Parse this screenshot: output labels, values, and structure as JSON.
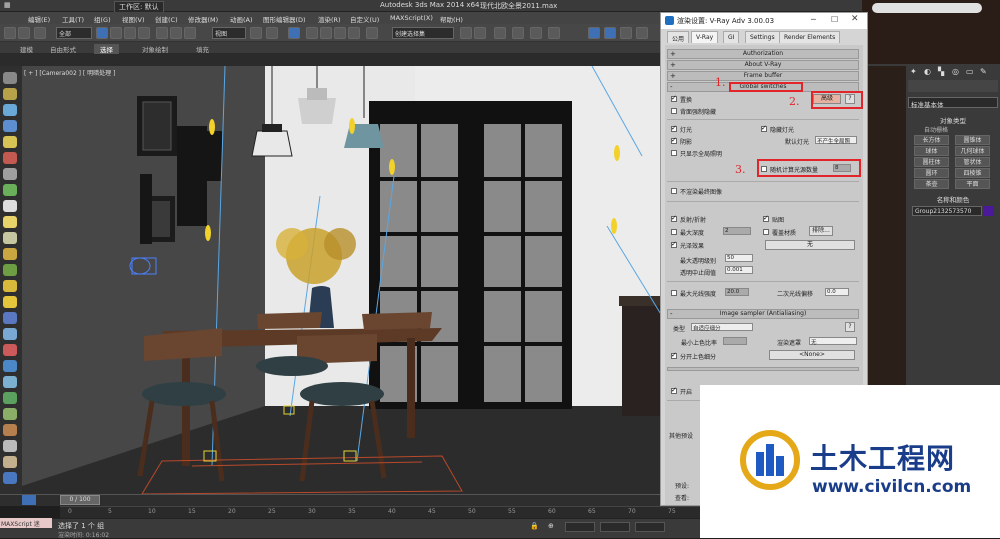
{
  "app": {
    "title": "Autodesk 3ds Max  2014 x64",
    "file": "现代北欧全景2011.max",
    "workspace": "工作区: 默认"
  },
  "menu": [
    "编辑(E)",
    "工具(T)",
    "组(G)",
    "视图(V)",
    "创建(C)",
    "修改器(M)",
    "动画(A)",
    "图形编辑器(D)",
    "渲染(R)",
    "自定义(U)",
    "MAXScript(X)",
    "帮助(H)"
  ],
  "toolbar": {
    "filter": "全部",
    "view": "视图",
    "selection_set": "创建选择集"
  },
  "ribbon": {
    "tabs": [
      "建模",
      "自由形式",
      "选择",
      "对象绘制",
      "填充"
    ],
    "active": "选择"
  },
  "viewport": {
    "label": "[ + ] [Camera002 ] [ 明暗处理 ]"
  },
  "dialog": {
    "title": "渲染设置: V-Ray Adv 3.00.03",
    "tabs": [
      "公用",
      "V-Ray",
      "GI",
      "Settings",
      "Render Elements"
    ],
    "active_tab": "V-Ray",
    "rollouts": [
      "Authorization",
      "About V-Ray",
      "Frame buffer",
      "Global switches"
    ],
    "global_switches": {
      "displacement": "置换",
      "force_backface": "背面强制隐藏",
      "mode_btn": "高级",
      "lights": "灯光",
      "hidden_lights": "隐藏灯光",
      "shadows": "阴影",
      "default_lights_label": "默认灯光",
      "default_lights_value": "不产生全局照",
      "show_gi_only": "只显示全局照明",
      "probabilistic_lights": "概率灯光",
      "prob_lights_label": "随机计算光源数量",
      "prob_lights_value": "8",
      "no_render_final": "不渲染最终图像",
      "reflect_refract": "反射/折射",
      "maps": "贴图",
      "max_depth": "最大深度",
      "max_depth_value": "2",
      "override_mtl": "覆盖材质",
      "exclude": "排除...",
      "override_value": "无",
      "glossy": "光泽效果",
      "max_transp": "最大透明级别",
      "max_transp_value": "50",
      "transp_cutoff": "透明中止阈值",
      "transp_cutoff_value": "0.001",
      "max_ray_intens": "最大光线强度",
      "max_ray_intens_value": "20.0",
      "secondary_bias": "二次光线偏移",
      "secondary_bias_value": "0.0"
    },
    "image_sampler": {
      "rollout": "Image sampler (Antialiasing)",
      "type_label": "类型",
      "type_value": "自适应细分",
      "min_shading": "最小上色比率",
      "render_mask": "渲染遮罩",
      "render_mask_value": "无",
      "divide_shading": "分开上色细分",
      "none_btn": "<None>",
      "on": "开启"
    },
    "bottom": {
      "label": "其他预设",
      "preset": "预设:",
      "view": "查看:"
    },
    "annotations": [
      "1.",
      "2.",
      "3."
    ]
  },
  "command_panel": {
    "dropdown": "标准基本体",
    "section_object_type": "对象类型",
    "autogrid": "自动栅格",
    "buttons": [
      "长方体",
      "圆锥体",
      "球体",
      "几何球体",
      "圆柱体",
      "管状体",
      "圆环",
      "四棱锥",
      "茶壶",
      "平面"
    ],
    "section_name_color": "名称和颜色",
    "object_name": "Group2132573570",
    "color": "#4a1a9a"
  },
  "timeline": {
    "slider": "0 / 100",
    "ticks": [
      "0",
      "5",
      "10",
      "15",
      "20",
      "25",
      "30",
      "35",
      "40",
      "45",
      "50",
      "55",
      "60",
      "65",
      "70",
      "75"
    ]
  },
  "status": {
    "maxscript": "MAXScript 迷",
    "selected": "选择了 1 个 组",
    "render_time": "渲染时间: 0:16:02"
  },
  "watermark": {
    "title": "土木工程网",
    "url": "www.civilcn.com"
  }
}
